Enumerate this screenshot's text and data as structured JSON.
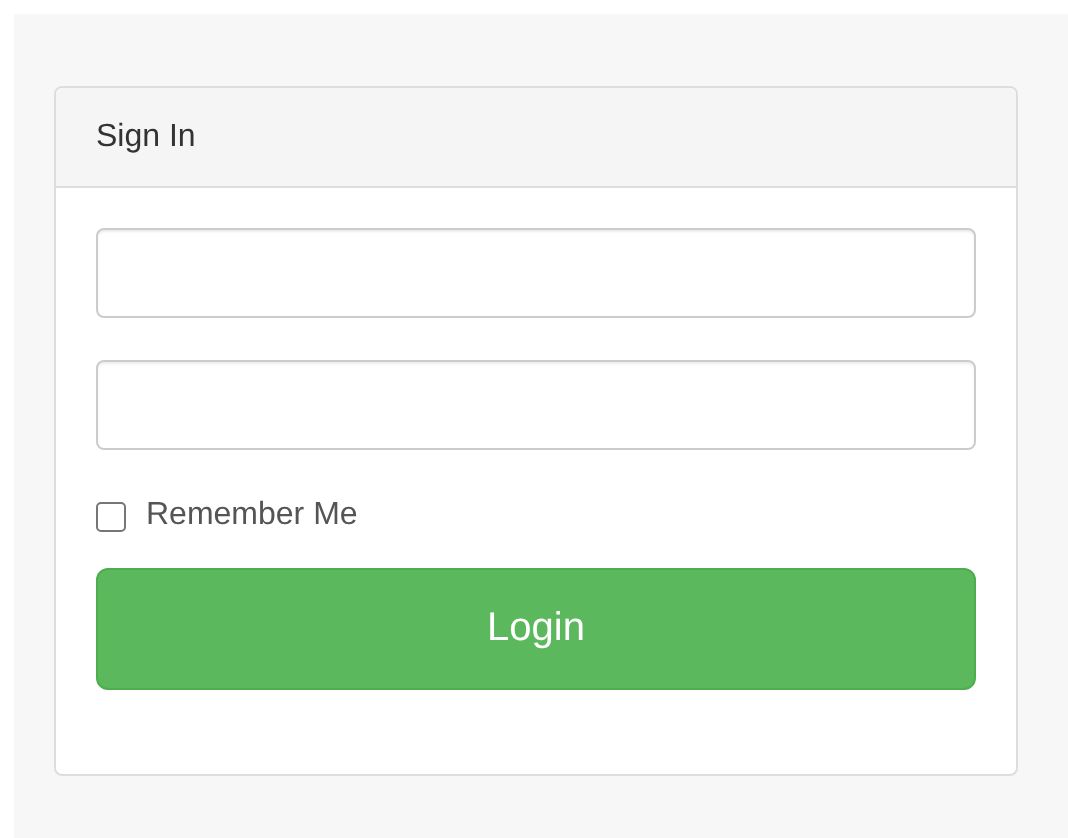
{
  "panel": {
    "title": "Sign In"
  },
  "fields": [
    {
      "kind": "text"
    },
    {
      "kind": "text"
    }
  ],
  "remember": {
    "label": "Remember Me",
    "checked": false
  },
  "button": {
    "label": "Login"
  }
}
